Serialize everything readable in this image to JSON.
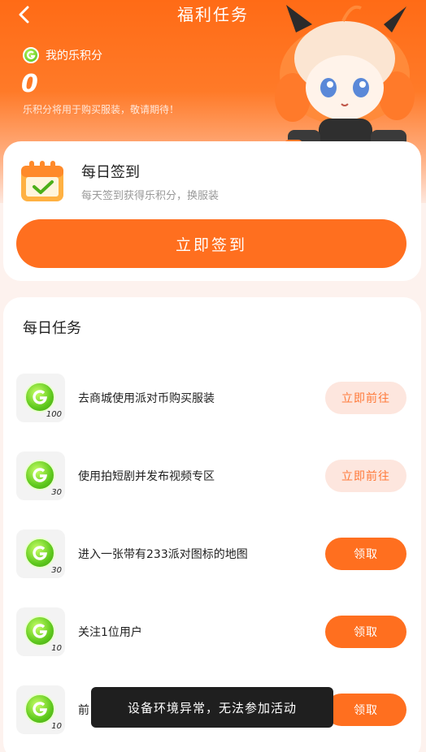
{
  "header": {
    "title": "福利任务"
  },
  "points": {
    "label": "我的乐积分",
    "value": "0",
    "description": "乐积分将用于购买服装，敬请期待！"
  },
  "signin": {
    "title": "每日签到",
    "description": "每天签到获得乐积分，换服装",
    "button_label": "立即签到"
  },
  "tasks": {
    "title": "每日任务",
    "items": [
      {
        "amount": "100",
        "text": "去商城使用派对币购买服装",
        "button": "立即前往",
        "button_type": "go"
      },
      {
        "amount": "30",
        "text": "使用拍短剧并发布视频专区",
        "button": "立即前往",
        "button_type": "go"
      },
      {
        "amount": "30",
        "text": "进入一张带有233派对图标的地图",
        "button": "领取",
        "button_type": "claim"
      },
      {
        "amount": "10",
        "text": "关注1位用户",
        "button": "领取",
        "button_type": "claim"
      },
      {
        "amount": "10",
        "text": "前",
        "button": "领取",
        "button_type": "claim"
      }
    ]
  },
  "toast": {
    "message": "设备环境异常，无法参加活动"
  },
  "colors": {
    "accent": "#ff6f1f",
    "go_button_bg": "#fde6de",
    "coin": "#5fc91e"
  }
}
